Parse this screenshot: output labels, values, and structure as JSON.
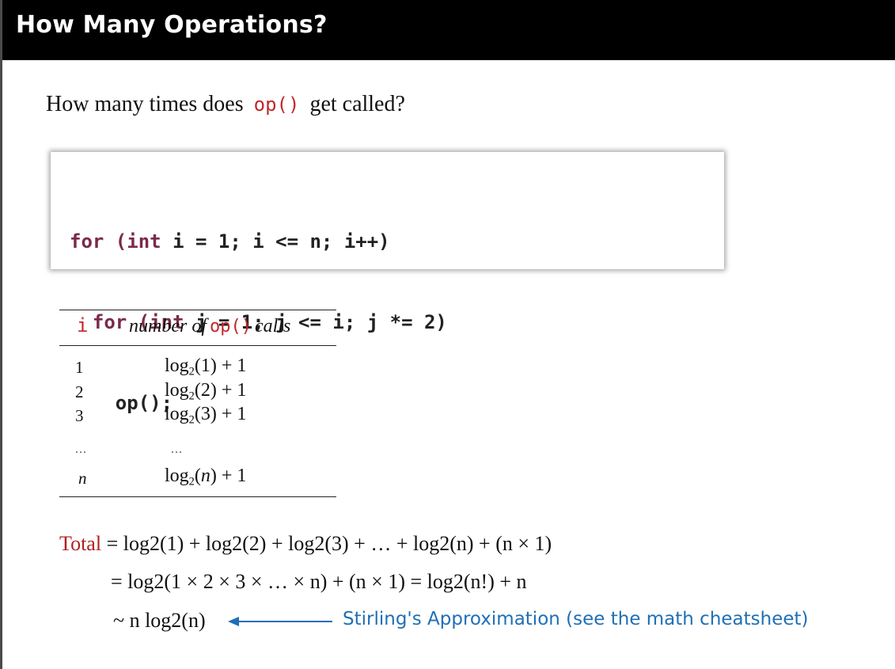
{
  "slide": {
    "title": "How Many Operations?"
  },
  "question": {
    "prefix": "How many times does",
    "code": "op()",
    "suffix": "get called?"
  },
  "code_block": {
    "lines": [
      {
        "indent": "",
        "keyword1": "for",
        "mid1": " (",
        "keyword2": "int",
        "rest": " i = 1; i <= n; i++)"
      },
      {
        "indent": "  ",
        "keyword1": "for",
        "mid1": " (",
        "keyword2": "int",
        "rest": " j = 1; j <= i; j *= 2)"
      },
      {
        "indent": "    ",
        "plain": "op();"
      }
    ]
  },
  "table": {
    "header_i": "i",
    "header_calls_prefix": "number of",
    "header_calls_code": "op()",
    "header_calls_suffix": "calls",
    "rows": [
      {
        "i": "1",
        "arg": "1"
      },
      {
        "i": "2",
        "arg": "2"
      },
      {
        "i": "3",
        "arg": "3"
      },
      {
        "i": "...",
        "arg": "..."
      },
      {
        "i": "n",
        "arg": "n"
      }
    ],
    "log_word": "log",
    "log_base": "2",
    "plus_one": "+ 1"
  },
  "derivation": {
    "total_label": "Total",
    "line1": "= log2(1) + log2(2) + log2(3) +  … + log2(n) + (n × 1)",
    "line2": "= log2(1 × 2 × 3 × … × n) + (n × 1) = log2(n!) + n",
    "line3": "~ n log2(n)"
  },
  "note": {
    "text": "Stirling's Approximation (see the math cheatsheet)",
    "color": "#1f6fb5"
  },
  "colors": {
    "code_red": "#c0282a",
    "keyword": "#7a2a4c",
    "title_bg": "#000000"
  }
}
